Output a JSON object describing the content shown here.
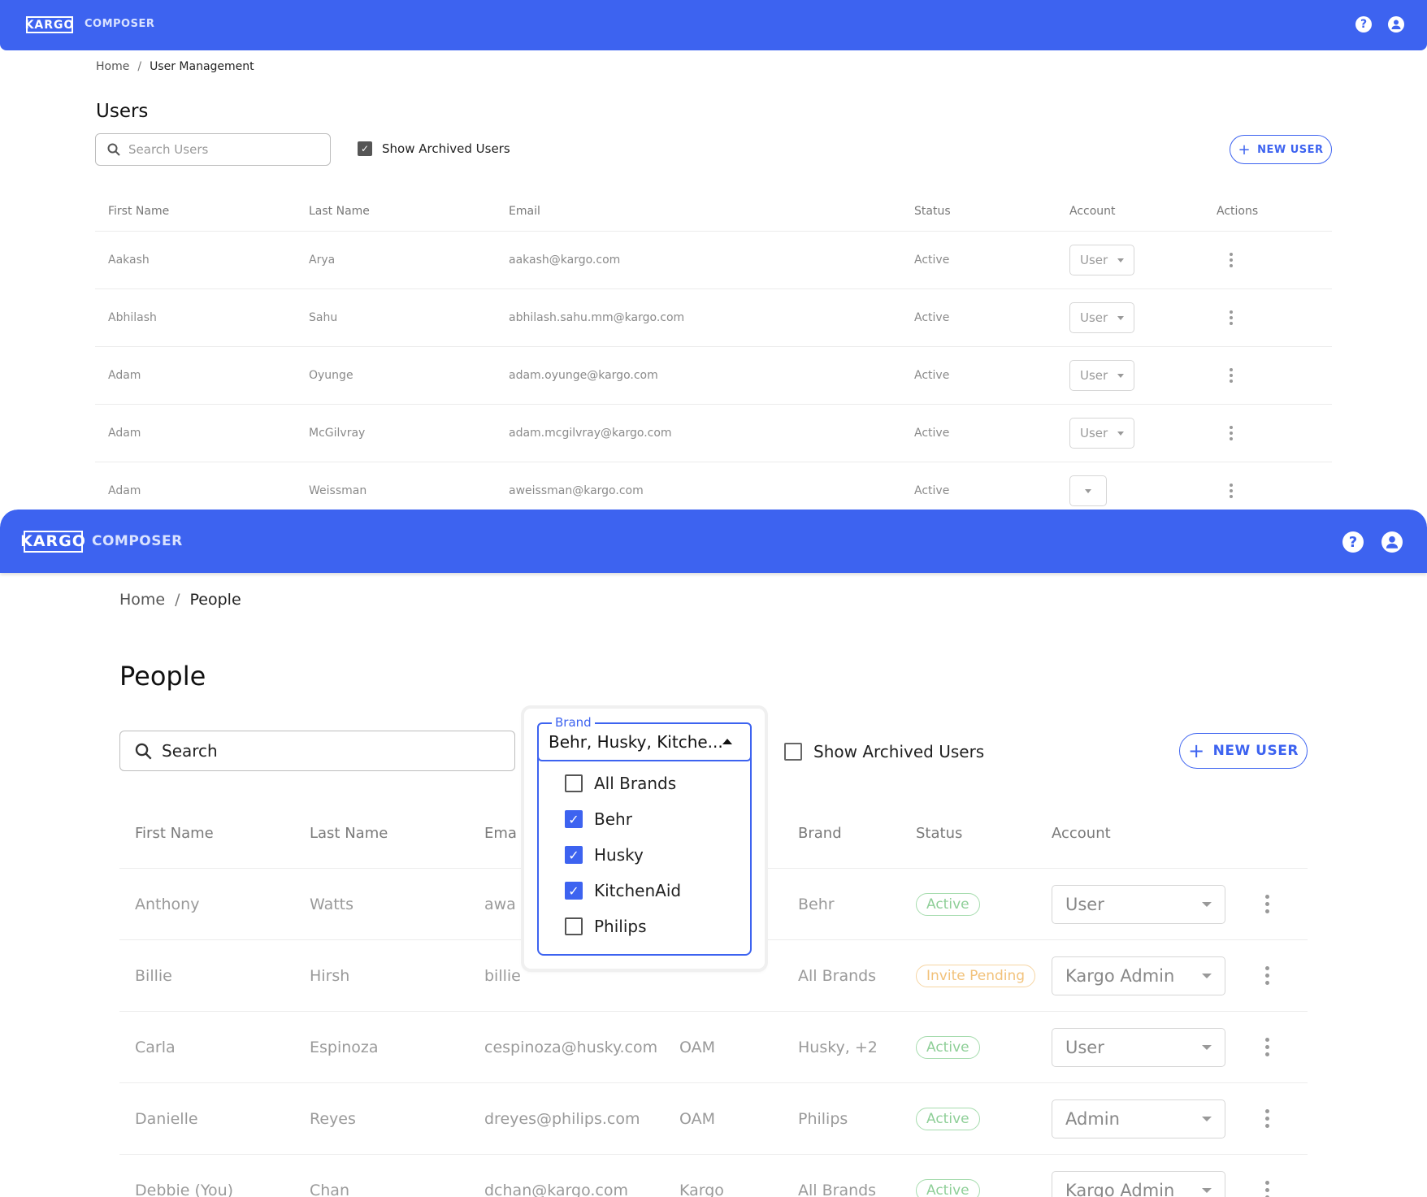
{
  "screen1": {
    "brand": {
      "logo": "KARGO",
      "product": "COMPOSER"
    },
    "icons": {
      "help": "help-icon",
      "account": "account-circle-icon"
    },
    "breadcrumb": {
      "home": "Home",
      "separator": "/",
      "current": "User Management"
    },
    "title": "Users",
    "search": {
      "placeholder": "Search Users"
    },
    "show_archived": {
      "label": "Show Archived Users",
      "checked": true
    },
    "new_user_label": "NEW USER",
    "columns": [
      "First Name",
      "Last Name",
      "Email",
      "Status",
      "Account",
      "Actions"
    ],
    "rows": [
      {
        "first": "Aakash",
        "last": "Arya",
        "email": "aakash@kargo.com",
        "status": "Active",
        "account": "User"
      },
      {
        "first": "Abhilash",
        "last": "Sahu",
        "email": "abhilash.sahu.mm@kargo.com",
        "status": "Active",
        "account": "User"
      },
      {
        "first": "Adam",
        "last": "Oyunge",
        "email": "adam.oyunge@kargo.com",
        "status": "Active",
        "account": "User"
      },
      {
        "first": "Adam",
        "last": "McGilvray",
        "email": "adam.mcgilvray@kargo.com",
        "status": "Active",
        "account": "User"
      },
      {
        "first": "Adam",
        "last": "Weissman",
        "email": "aweissman@kargo.com",
        "status": "Active",
        "account": ""
      }
    ]
  },
  "screen2": {
    "brand": {
      "logo": "KARGO",
      "product": "COMPOSER"
    },
    "icons": {
      "help": "help-icon",
      "account": "account-circle-icon"
    },
    "breadcrumb": {
      "home": "Home",
      "separator": "/",
      "current": "People"
    },
    "title": "People",
    "search": {
      "placeholder": "Search"
    },
    "brand_filter": {
      "legend": "Brand",
      "value": "Behr, Husky, Kitche...",
      "options": [
        {
          "label": "All Brands",
          "checked": false
        },
        {
          "label": "Behr",
          "checked": true
        },
        {
          "label": "Husky",
          "checked": true
        },
        {
          "label": "KitchenAid",
          "checked": true
        },
        {
          "label": "Philips",
          "checked": false
        }
      ]
    },
    "show_archived": {
      "label": "Show Archived Users",
      "checked": false
    },
    "new_user_label": "NEW USER",
    "columns": {
      "first": "First Name",
      "last": "Last Name",
      "email": "Ema",
      "brand": "Brand",
      "status": "Status",
      "account": "Account"
    },
    "rows": [
      {
        "first": "Anthony",
        "last": "Watts",
        "email": "awa",
        "org": "",
        "brand": "Behr",
        "status": "Active",
        "account": "User"
      },
      {
        "first": "Billie",
        "last": "Hirsh",
        "email": "billie",
        "org": "",
        "brand": "All Brands",
        "status": "Invite Pending",
        "account": "Kargo Admin"
      },
      {
        "first": "Carla",
        "last": "Espinoza",
        "email": "cespinoza@husky.com",
        "org": "OAM",
        "brand": "Husky, +2",
        "status": "Active",
        "account": "User"
      },
      {
        "first": "Danielle",
        "last": "Reyes",
        "email": "dreyes@philips.com",
        "org": "OAM",
        "brand": "Philips",
        "status": "Active",
        "account": "Admin"
      },
      {
        "first": "Debbie (You)",
        "last": "Chan",
        "email": "dchan@kargo.com",
        "org": "Kargo",
        "brand": "All Brands",
        "status": "Active",
        "account": "Kargo Admin"
      }
    ]
  }
}
